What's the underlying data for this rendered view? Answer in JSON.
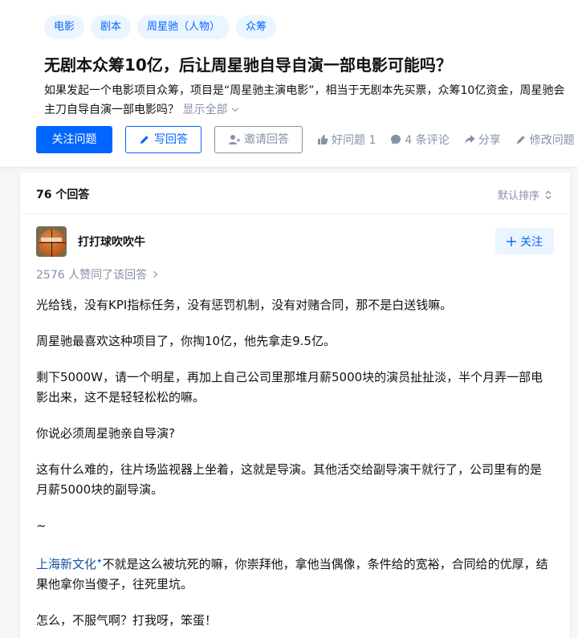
{
  "question": {
    "topics": [
      "电影",
      "剧本",
      "周星驰（人物）",
      "众筹"
    ],
    "title": "无剧本众筹10亿，后让周星驰自导自演一部电影可能吗？",
    "detail": "如果发起一个电影项目众筹，项目是“周星驰主演电影”，相当于无剧本先买票，众筹10亿资金，周星驰会主刀自导自演一部电影吗？",
    "show_all": "显示全部",
    "actions": {
      "follow": "关注问题",
      "write": "写回答",
      "invite": "邀请回答",
      "good": "好问题 1",
      "comments": "4 条评论",
      "share": "分享",
      "edit": "修改问题"
    }
  },
  "answers": {
    "count": "76 个回答",
    "sort": "默认排序",
    "first": {
      "author": "打打球吹吹牛",
      "follow": "关注",
      "upvotes": "2576 人赞同了该回答",
      "paragraphs": [
        "光给钱，没有KPI指标任务，没有惩罚机制，没有对赌合同，那不是白送钱嘛。",
        "周星驰最喜欢这种项目了，你掏10亿，他先拿走9.5亿。",
        "剩下5000W，请一个明星，再加上自己公司里那堆月薪5000块的演员扯扯淡，半个月弄一部电影出来，这不是轻轻松松的嘛。",
        "你说必须周星驰亲自导演?",
        "这有什么难的，往片场监视器上坐着，这就是导演。其他活交给副导演干就行了，公司里有的是月薪5000块的副导演。",
        "~"
      ],
      "link_text": "上海新文化",
      "link_rest": "不就是这么被坑死的嘛，你崇拜他，拿他当偶像，条件给的宽裕，合同给的优厚，结果他拿你当傻子，往死里坑。",
      "last": "怎么，不服气啊？打我呀，笨蛋！"
    }
  }
}
